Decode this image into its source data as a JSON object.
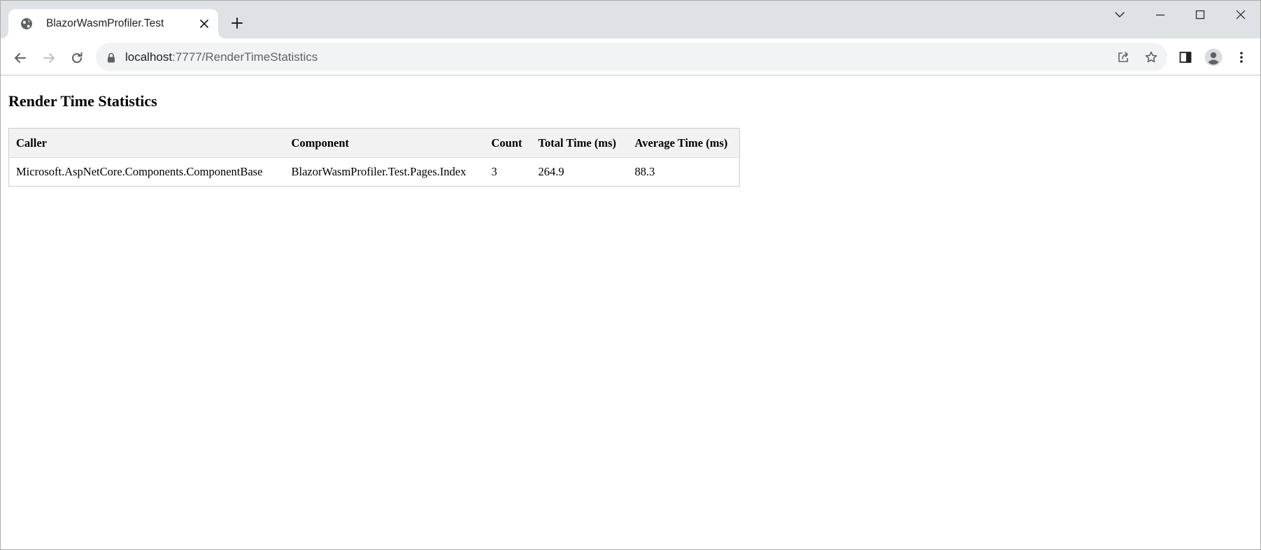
{
  "browser": {
    "tab": {
      "title": "BlazorWasmProfiler.Test",
      "favicon": "globe-icon"
    },
    "address_bar": {
      "host": "localhost",
      "path": ":7777/RenderTimeStatistics"
    },
    "colors": {
      "tab_strip": "#dee1e6",
      "omnibox": "#f1f3f4",
      "icon": "#5f6368"
    }
  },
  "page": {
    "title": "Render Time Statistics",
    "table": {
      "headers": [
        "Caller",
        "Component",
        "Count",
        "Total Time (ms)",
        "Average Time (ms)"
      ],
      "rows": [
        [
          "Microsoft.AspNetCore.Components.ComponentBase",
          "BlazorWasmProfiler.Test.Pages.Index",
          "3",
          "264.9",
          "88.3"
        ]
      ]
    }
  }
}
